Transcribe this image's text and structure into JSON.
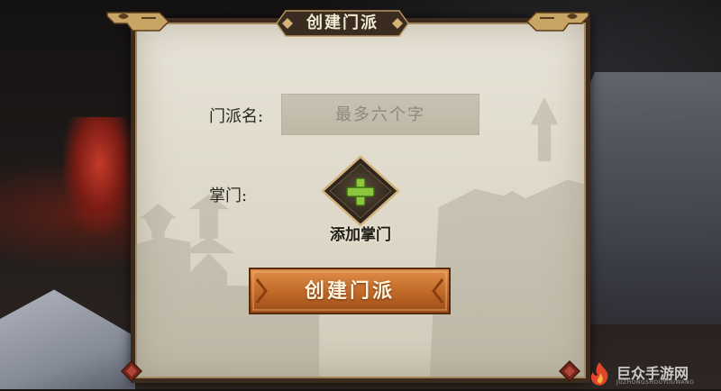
{
  "dialog": {
    "title": "创建门派"
  },
  "form": {
    "name_label": "门派名:",
    "name_input_placeholder": "最多六个字",
    "name_input_value": "",
    "leader_label": "掌门:",
    "add_leader_label": "添加掌门"
  },
  "actions": {
    "create_label": "创建门派"
  },
  "watermark": {
    "logo_text": "巨众手游网",
    "logo_sub": "JUZHONGSHOUYOUWANG"
  },
  "icons": {
    "add": "plus-icon"
  },
  "colors": {
    "panel_bg": "#e0dccf",
    "frame": "#3c2a1c",
    "button_orange": "#c26b2a",
    "plus_green": "#8ec63f",
    "diamond_dark": "#3a2f24"
  }
}
